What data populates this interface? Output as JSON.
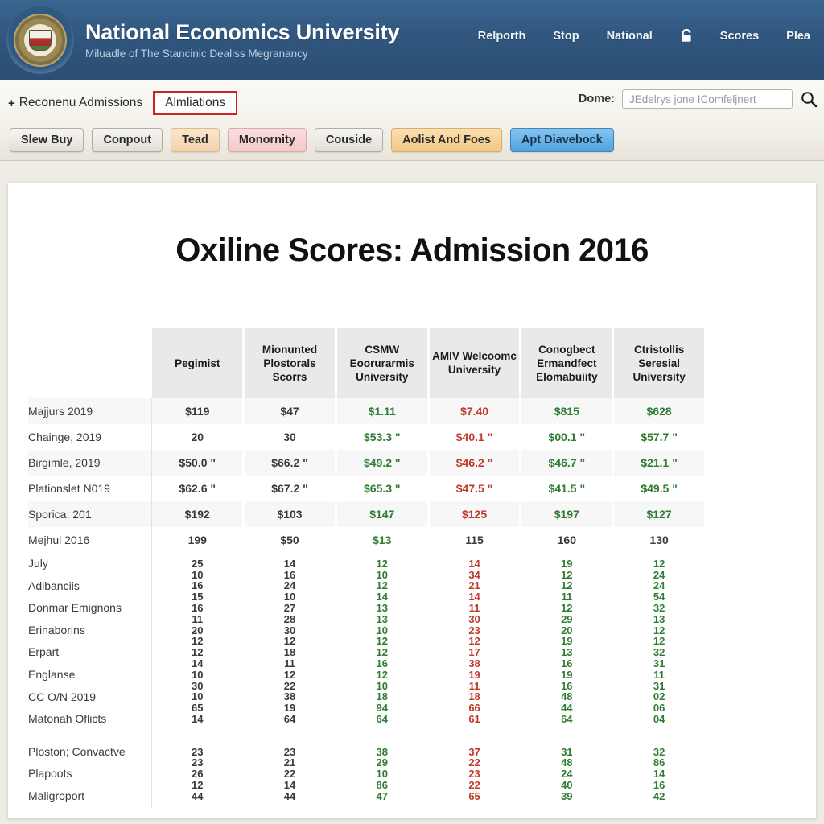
{
  "header": {
    "title": "National Economics University",
    "tagline": "Miluadle of The Stancinic Dealiss Megranancy",
    "logo_icon": "university-seal-icon",
    "nav": [
      {
        "label": "Relporth"
      },
      {
        "label": "Stop"
      },
      {
        "label": "National"
      },
      {
        "label": "Scores"
      },
      {
        "label": "Plea"
      }
    ],
    "lock_icon": "lock-icon"
  },
  "subbar": {
    "plus_icon": "plus-icon",
    "breadcrumb": "Reconenu Admissions",
    "active_tab": "Almliations",
    "search": {
      "label": "Dome:",
      "placeholder": "JEdelrys jone IComfeljnert",
      "value": "",
      "icon": "search-icon"
    },
    "buttons": [
      {
        "label": "Slew Buy",
        "style": "grey"
      },
      {
        "label": "Conpout",
        "style": "grey"
      },
      {
        "label": "Tead",
        "style": "orange"
      },
      {
        "label": "Monornity",
        "style": "pink"
      },
      {
        "label": "Couside",
        "style": "grey"
      },
      {
        "label": "Aolist And Foes",
        "style": "amber"
      },
      {
        "label": "Apt Diavebock",
        "style": "blue"
      }
    ]
  },
  "document": {
    "title": "Oxiline Scores: Admission 2016"
  },
  "chart_data": {
    "type": "table",
    "title": "Oxiline Scores: Admission 2016",
    "columns": [
      "",
      "Pegimist",
      "Mionunted Plostorals Scorrs",
      "CSMW Eoorurarmis University",
      "AMIV Welcoomc University",
      "Conogbect Ermandfect Elomabuiity",
      "Ctristollis Seresial University"
    ],
    "rows": [
      {
        "label": "Majjurs 2019",
        "values": [
          "$119",
          "$47",
          "$1.11",
          "$7.40",
          "$815",
          "$628"
        ],
        "colors": [
          "neutral",
          "neutral",
          "pos",
          "neg",
          "pos",
          "pos"
        ]
      },
      {
        "label": "Chainge, 2019",
        "values": [
          "20",
          "30",
          "$53.3 \"",
          "$40.1 \"",
          "$00.1 \"",
          "$57.7 \""
        ],
        "colors": [
          "neutral",
          "neutral",
          "pos",
          "neg",
          "pos",
          "pos"
        ]
      },
      {
        "label": "Birgimle, 2019",
        "values": [
          "$50.0 \"",
          "$66.2 \"",
          "$49.2 \"",
          "$46.2 \"",
          "$46.7 \"",
          "$21.1 \""
        ],
        "colors": [
          "neutral",
          "neutral",
          "pos",
          "neg",
          "pos",
          "pos"
        ]
      },
      {
        "label": "Plationslet N019",
        "values": [
          "$62.6 \"",
          "$67.2 \"",
          "$65.3 \"",
          "$47.5 \"",
          "$41.5 \"",
          "$49.5 \""
        ],
        "colors": [
          "neutral",
          "neutral",
          "pos",
          "neg",
          "pos",
          "pos"
        ]
      },
      {
        "label": "Sporica; 201",
        "values": [
          "$192",
          "$103",
          "$147",
          "$125",
          "$197",
          "$127"
        ],
        "colors": [
          "neutral",
          "neutral",
          "pos",
          "neg",
          "pos",
          "pos"
        ]
      },
      {
        "label": "Mejhul 2016",
        "values": [
          "199",
          "$50",
          "$13",
          "115",
          "160",
          "130"
        ],
        "colors": [
          "neutral",
          "neutral",
          "pos",
          "neg",
          "neutral",
          "neutral"
        ]
      }
    ],
    "dense_block_1": {
      "labels": [
        "July",
        "Adibanciis",
        "Donmar Emignons",
        "Erinaborins",
        "Erpart",
        "Englanse",
        "CC O/N 2019",
        "Matonah Oflicts"
      ],
      "series": [
        {
          "name": "Pegimist",
          "color": "neutral",
          "values": [
            "25",
            "10",
            "16",
            "15",
            "16",
            "11",
            "20",
            "12",
            "12",
            "14",
            "10",
            "30",
            "10",
            "65",
            "14"
          ]
        },
        {
          "name": "Mionunted Plostorals Scorrs",
          "color": "neutral",
          "values": [
            "14",
            "16",
            "24",
            "10",
            "27",
            "28",
            "30",
            "12",
            "18",
            "11",
            "12",
            "22",
            "38",
            "19",
            "64"
          ]
        },
        {
          "name": "CSMW Eoorurarmis University",
          "color": "pos",
          "values": [
            "12",
            "10",
            "12",
            "14",
            "13",
            "13",
            "10",
            "12",
            "12",
            "16",
            "12",
            "10",
            "18",
            "94",
            "64"
          ]
        },
        {
          "name": "AMIV Welcoomc University",
          "color": "neg",
          "values": [
            "14",
            "34",
            "21",
            "14",
            "11",
            "30",
            "23",
            "12",
            "17",
            "38",
            "19",
            "11",
            "18",
            "66",
            "61"
          ]
        },
        {
          "name": "Conogbect Ermandfect Elomabuiity",
          "color": "pos",
          "values": [
            "19",
            "12",
            "12",
            "11",
            "12",
            "29",
            "20",
            "19",
            "13",
            "16",
            "19",
            "16",
            "48",
            "44",
            "64"
          ]
        },
        {
          "name": "Ctristollis Seresial University",
          "color": "pos",
          "values": [
            "12",
            "24",
            "24",
            "54",
            "32",
            "13",
            "12",
            "12",
            "32",
            "31",
            "11",
            "31",
            "02",
            "06",
            "04"
          ]
        }
      ]
    },
    "dense_block_2": {
      "labels": [
        "Ploston; Convactve",
        "Plapoots",
        "Maligroport"
      ],
      "series": [
        {
          "name": "Pegimist",
          "color": "neutral",
          "values": [
            "23",
            "23",
            "26",
            "12",
            "44"
          ]
        },
        {
          "name": "Mionunted Plostorals Scorrs",
          "color": "neutral",
          "values": [
            "23",
            "21",
            "22",
            "14",
            "44"
          ]
        },
        {
          "name": "CSMW Eoorurarmis University",
          "color": "pos",
          "values": [
            "38",
            "29",
            "10",
            "86",
            "47"
          ]
        },
        {
          "name": "AMIV Welcoomc University",
          "color": "neg",
          "values": [
            "37",
            "22",
            "23",
            "22",
            "65"
          ]
        },
        {
          "name": "Conogbect Ermandfect Elomabuiity",
          "color": "pos",
          "values": [
            "31",
            "48",
            "24",
            "40",
            "39"
          ]
        },
        {
          "name": "Ctristollis Seresial University",
          "color": "pos",
          "values": [
            "32",
            "86",
            "14",
            "16",
            "42"
          ]
        }
      ]
    }
  },
  "colors": {
    "header_blue": "#31577f",
    "accent_red": "#cc2222",
    "positive_green": "#2e7d32",
    "negative_red": "#c0392b",
    "primary_button_blue": "#4ea3e0"
  }
}
